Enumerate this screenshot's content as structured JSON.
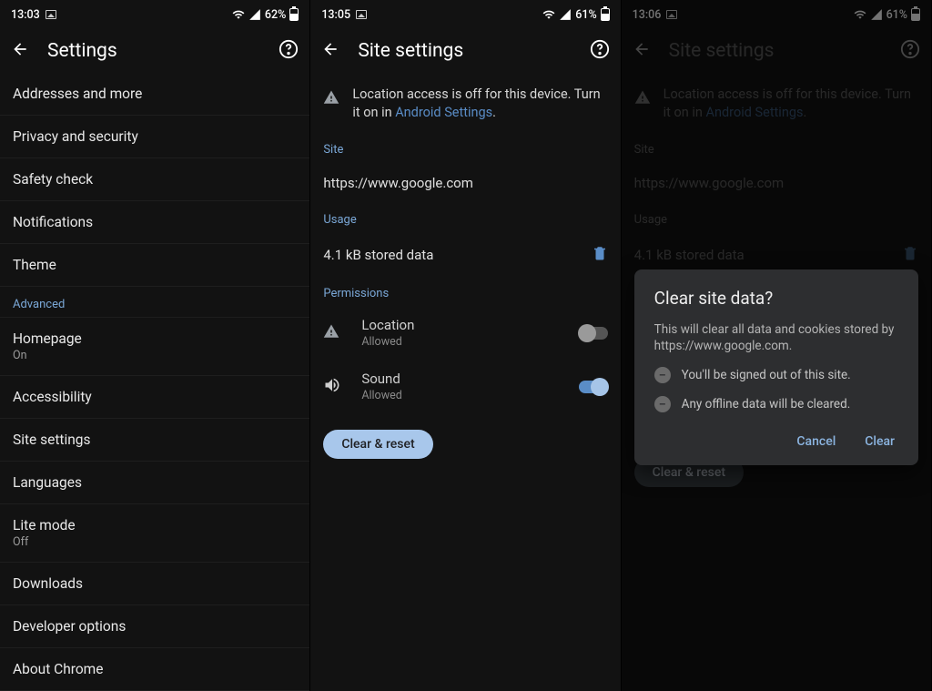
{
  "s1": {
    "status": {
      "time": "13:03",
      "battery": "62%"
    },
    "title": "Settings",
    "items": [
      {
        "label": "Addresses and more"
      },
      {
        "label": "Privacy and security"
      },
      {
        "label": "Safety check"
      },
      {
        "label": "Notifications"
      },
      {
        "label": "Theme"
      }
    ],
    "advanced_header": "Advanced",
    "advanced": [
      {
        "label": "Homepage",
        "sub": "On"
      },
      {
        "label": "Accessibility"
      },
      {
        "label": "Site settings"
      },
      {
        "label": "Languages"
      },
      {
        "label": "Lite mode",
        "sub": "Off"
      },
      {
        "label": "Downloads"
      },
      {
        "label": "Developer options"
      },
      {
        "label": "About Chrome"
      }
    ]
  },
  "s2": {
    "status": {
      "time": "13:05",
      "battery": "61%"
    },
    "title": "Site settings",
    "notice_prefix": "Location access is off for this device. Turn it on in ",
    "notice_link": "Android Settings",
    "notice_suffix": ".",
    "site_header": "Site",
    "site_url": "https://www.google.com",
    "usage_header": "Usage",
    "usage_text": "4.1 kB stored data",
    "perm_header": "Permissions",
    "perm": [
      {
        "name": "Location",
        "status": "Allowed",
        "on": false
      },
      {
        "name": "Sound",
        "status": "Allowed",
        "on": true
      }
    ],
    "clear_button": "Clear & reset"
  },
  "s3": {
    "status": {
      "time": "13:06",
      "battery": "61%"
    },
    "title": "Site settings",
    "notice_prefix": "Location access is off for this device. Turn it on in ",
    "notice_link": "Android Settings",
    "notice_suffix": ".",
    "site_header": "Site",
    "site_url": "https://www.google.com",
    "usage_header": "Usage",
    "usage_text": "4.1 kB stored data",
    "clear_button": "Clear & reset",
    "dialog": {
      "title": "Clear site data?",
      "body": "This will clear all data and cookies stored by https://www.google.com.",
      "items": [
        "You'll be signed out of this site.",
        "Any offline data will be cleared."
      ],
      "cancel": "Cancel",
      "confirm": "Clear"
    }
  }
}
